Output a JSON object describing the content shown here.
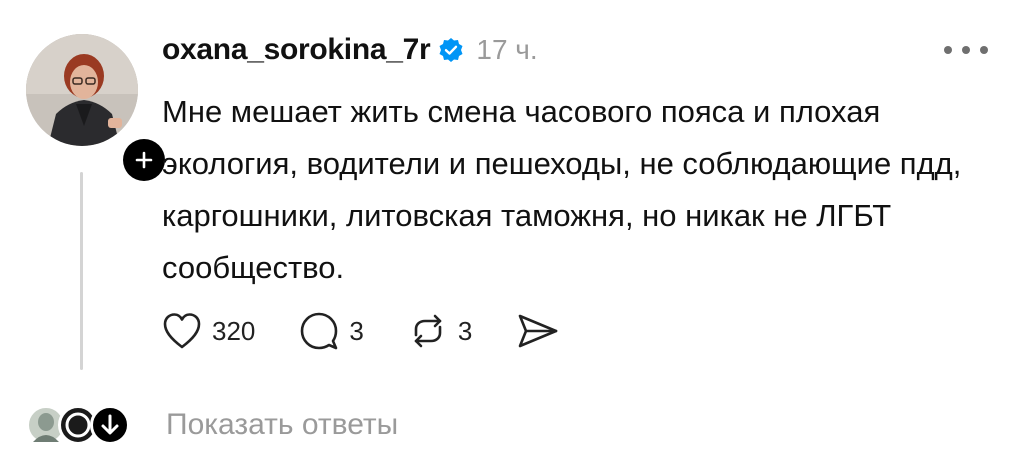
{
  "post": {
    "username": "oxana_sorokina_7r",
    "verified": true,
    "time": "17 ч.",
    "text": "Мне мешает жить смена часового пояса и плохая экология, водители и пешеходы, не соблюдающие пдд, каргошники, литовская таможня, но никак не ЛГБТ сообщество."
  },
  "actions": {
    "likes": "320",
    "comments": "3",
    "reposts": "3"
  },
  "replies": {
    "show_label": "Показать ответы"
  },
  "colors": {
    "verified": "#0095f6",
    "muted_text": "#9a9a9a",
    "thread_line": "#d4d4d4"
  },
  "icons": [
    "plus-icon",
    "verified-icon",
    "more-icon",
    "heart-icon",
    "comment-icon",
    "repost-icon",
    "share-icon",
    "chevron-down-icon"
  ]
}
